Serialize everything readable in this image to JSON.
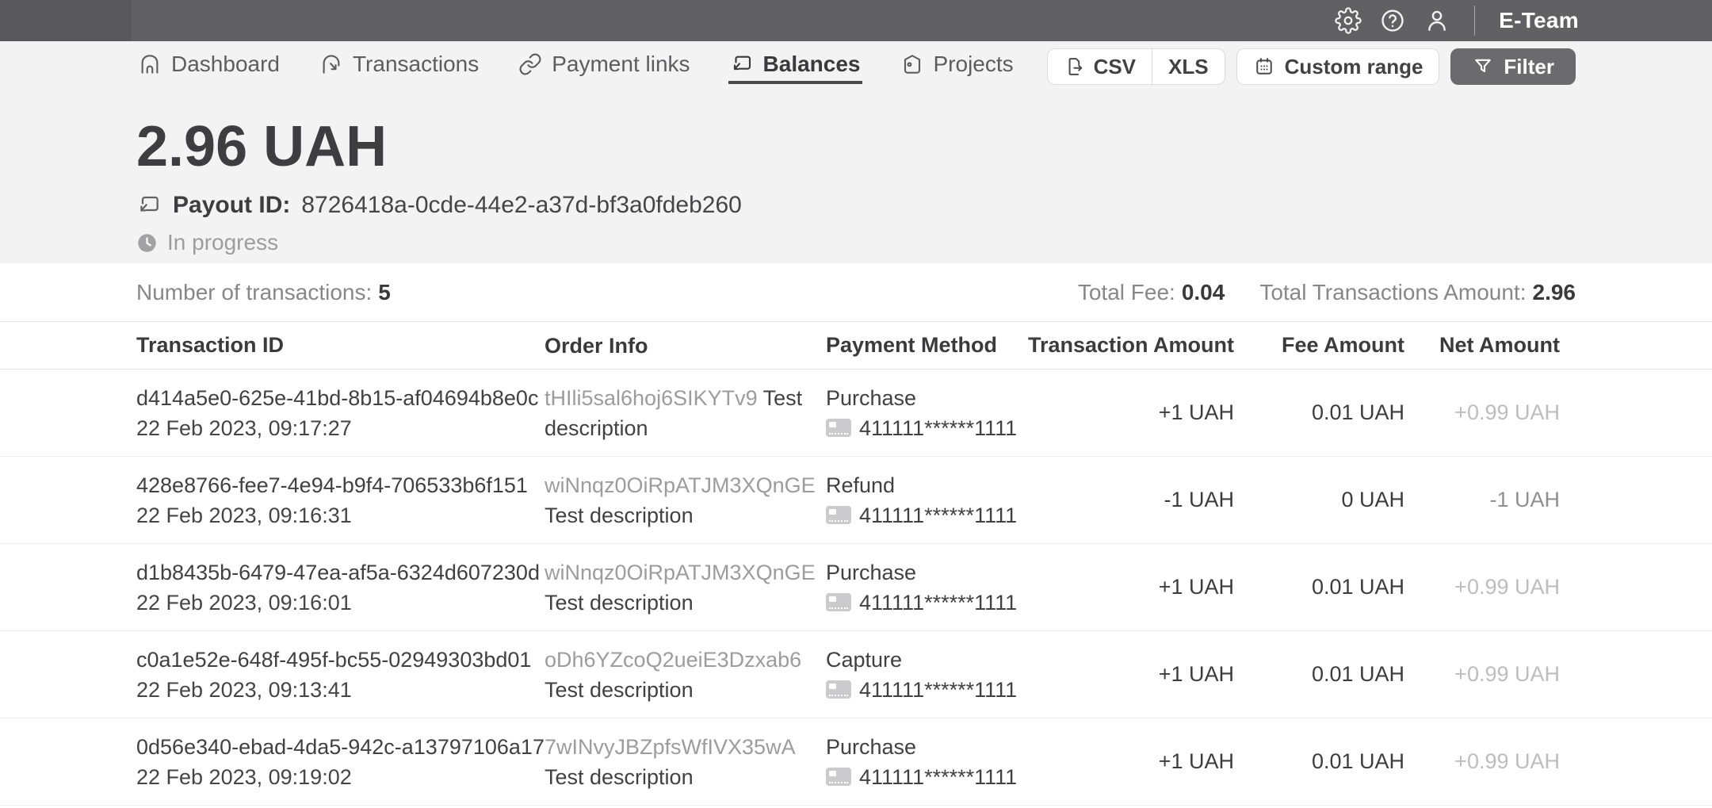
{
  "topbar": {
    "team_label": "E-Team",
    "icons": [
      "settings-icon",
      "help-icon",
      "user-icon"
    ]
  },
  "nav": {
    "tabs": [
      {
        "label": "Dashboard",
        "icon": "home-icon",
        "active": false
      },
      {
        "label": "Transactions",
        "icon": "transactions-icon",
        "active": false
      },
      {
        "label": "Payment links",
        "icon": "link-icon",
        "active": false
      },
      {
        "label": "Balances",
        "icon": "balance-icon",
        "active": true
      },
      {
        "label": "Projects",
        "icon": "projects-icon",
        "active": false
      }
    ],
    "actions": {
      "csv_label": "CSV",
      "xls_label": "XLS",
      "custom_range_label": "Custom range",
      "filter_label": "Filter"
    }
  },
  "payout": {
    "amount": "2.96 UAH",
    "payout_id_label": "Payout ID:",
    "payout_id": "8726418a-0cde-44e2-a37d-bf3a0fdeb260",
    "status": "In progress"
  },
  "summary": {
    "transactions_label": "Number of transactions:",
    "transactions_count": "5",
    "total_fee_label": "Total Fee:",
    "total_fee": "0.04",
    "total_amount_label": "Total Transactions Amount:",
    "total_amount": "2.96"
  },
  "table": {
    "columns": [
      "Transaction ID",
      "Order Info",
      "Payment Method",
      "Transaction Amount",
      "Fee Amount",
      "Net Amount"
    ],
    "rows": [
      {
        "id": "d414a5e0-625e-41bd-8b15-af04694b8e0c",
        "datetime": "22 Feb 2023, 09:17:27",
        "order_ref": "tHIli5sal6hoj6SIKYTv9",
        "order_desc": "Test description",
        "method_type": "Purchase",
        "card": "411111******1111",
        "amount": "+1 UAH",
        "fee": "0.01 UAH",
        "net": "+0.99 UAH",
        "net_tone": "light"
      },
      {
        "id": "428e8766-fee7-4e94-b9f4-706533b6f151",
        "datetime": "22 Feb 2023, 09:16:31",
        "order_ref": "wiNnqz0OiRpATJM3XQnGE",
        "order_desc": "Test description",
        "method_type": "Refund",
        "card": "411111******1111",
        "amount": "-1 UAH",
        "fee": "0 UAH",
        "net": "-1 UAH",
        "net_tone": "medium"
      },
      {
        "id": "d1b8435b-6479-47ea-af5a-6324d607230d",
        "datetime": "22 Feb 2023, 09:16:01",
        "order_ref": "wiNnqz0OiRpATJM3XQnGE",
        "order_desc": "Test description",
        "method_type": "Purchase",
        "card": "411111******1111",
        "amount": "+1 UAH",
        "fee": "0.01 UAH",
        "net": "+0.99 UAH",
        "net_tone": "light"
      },
      {
        "id": "c0a1e52e-648f-495f-bc55-02949303bd01",
        "datetime": "22 Feb 2023, 09:13:41",
        "order_ref": "oDh6YZcoQ2ueiE3Dzxab6",
        "order_desc": "Test description",
        "method_type": "Capture",
        "card": "411111******1111",
        "amount": "+1 UAH",
        "fee": "0.01 UAH",
        "net": "+0.99 UAH",
        "net_tone": "light"
      },
      {
        "id": "0d56e340-ebad-4da5-942c-a13797106a17",
        "datetime": "22 Feb 2023, 09:19:02",
        "order_ref": "7wINvyJBZpfsWfIVX35wA",
        "order_desc": "Test description",
        "method_type": "Purchase",
        "card": "411111******1111",
        "amount": "+1 UAH",
        "fee": "0.01 UAH",
        "net": "+0.99 UAH",
        "net_tone": "light"
      }
    ]
  },
  "colors": {
    "topbar": "#616163",
    "topbar_left": "#59595b",
    "page_gray": "#f3f3f3",
    "text_dark": "#3e3e40",
    "text_muted": "#9c9c9e",
    "net_light": "#bdbdbf",
    "filter_button": "#6b6b6d",
    "active_tab_underline": "#4a4a4c"
  }
}
